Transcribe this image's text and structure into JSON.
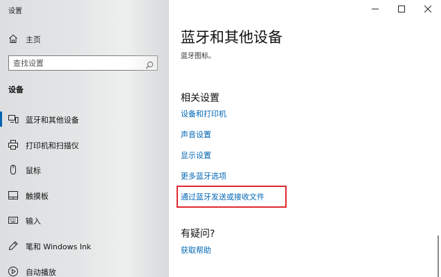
{
  "window": {
    "title": "设置"
  },
  "sidebar": {
    "home_label": "主页",
    "search_placeholder": "查找设置",
    "section_label": "设备",
    "items": [
      {
        "label": "蓝牙和其他设备",
        "icon": "bluetooth-devices-icon",
        "active": true
      },
      {
        "label": "打印机和扫描仪",
        "icon": "printer-icon",
        "active": false
      },
      {
        "label": "鼠标",
        "icon": "mouse-icon",
        "active": false
      },
      {
        "label": "触摸板",
        "icon": "touchpad-icon",
        "active": false
      },
      {
        "label": "输入",
        "icon": "keyboard-icon",
        "active": false
      },
      {
        "label": "笔和 Windows Ink",
        "icon": "pen-icon",
        "active": false
      },
      {
        "label": "自动播放",
        "icon": "autoplay-icon",
        "active": false
      }
    ]
  },
  "main": {
    "title": "蓝牙和其他设备",
    "subtitle": "蓝牙图标。",
    "related_heading": "相关设置",
    "links": [
      "设备和打印机",
      "声音设置",
      "显示设置",
      "更多蓝牙选项",
      "通过蓝牙发送或接收文件"
    ],
    "question_heading": "有疑问?",
    "help_link": "获取帮助"
  },
  "colors": {
    "accent": "#0063b1",
    "link": "#0066b4",
    "highlight": "#e0282e"
  }
}
